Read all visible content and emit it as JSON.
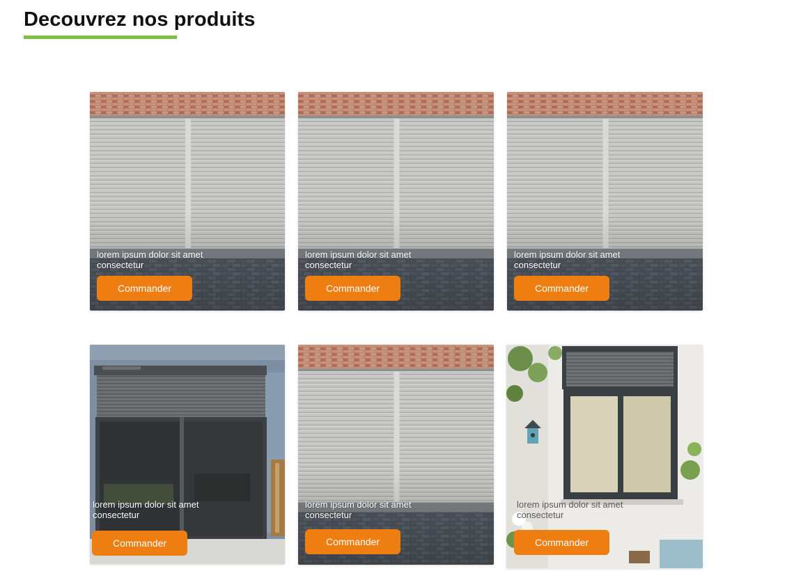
{
  "section": {
    "title": "Decouvrez nos produits",
    "accent_color": "#7dc242"
  },
  "button_color": "#ee7d12",
  "products": [
    {
      "image": "roller-shutter-garage-photo",
      "caption_line1": "lorem ipsum dolor sit amet",
      "caption_line2": "consectetur",
      "button_label": "Commander"
    },
    {
      "image": "roller-shutter-garage-photo",
      "caption_line1": "lorem ipsum dolor sit amet",
      "caption_line2": "consectetur",
      "button_label": "Commander"
    },
    {
      "image": "roller-shutter-garage-photo",
      "caption_line1": "lorem ipsum dolor sit amet",
      "caption_line2": "consectetur",
      "button_label": "Commander"
    },
    {
      "image": "patio-door-shutter-photo",
      "caption_line1": "lorem ipsum dolor sit amet",
      "caption_line2": "consectetur",
      "button_label": "Commander"
    },
    {
      "image": "roller-shutter-garage-photo",
      "caption_line1": "lorem ipsum dolor sit amet",
      "caption_line2": "consectetur",
      "button_label": "Commander"
    },
    {
      "image": "window-shutter-garden-photo",
      "caption_line1": "lorem ipsum dolor sit amet",
      "caption_line2": "consectetur",
      "button_label": "Commander"
    }
  ]
}
